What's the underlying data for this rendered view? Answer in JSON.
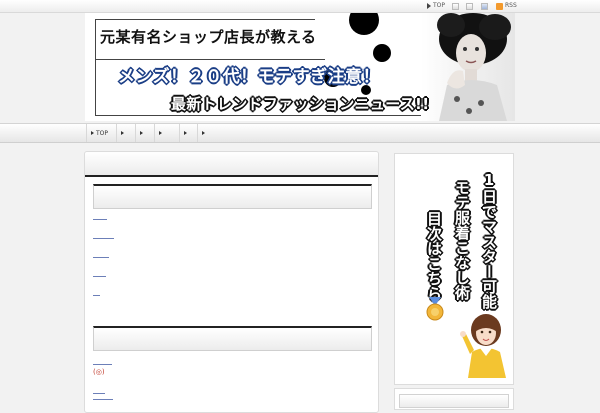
{
  "topbar": {
    "top_label": "TOP",
    "rss_label": "RSS"
  },
  "banner": {
    "line1": "元某有名ショップ店長が教える",
    "line2": "メンズ！２０代！モテすぎ注意！",
    "line3": "最新トレンドファッションニュース!!"
  },
  "nav": {
    "items": [
      {
        "label": "TOP"
      },
      {
        "label": ""
      },
      {
        "label": ""
      },
      {
        "label": ""
      },
      {
        "label": ""
      },
      {
        "label": ""
      }
    ]
  },
  "main": {
    "entry_marker": "(◎)"
  },
  "sidebar": {
    "ad_col1": "1日でマスター可能",
    "ad_col2": "モテ服着こなし術",
    "ad_col3": "目次はこちら"
  },
  "colors": {
    "accent_link": "#6c7fb8",
    "banner_blue": "#1b3e86",
    "rss_orange": "#f39a2d"
  }
}
